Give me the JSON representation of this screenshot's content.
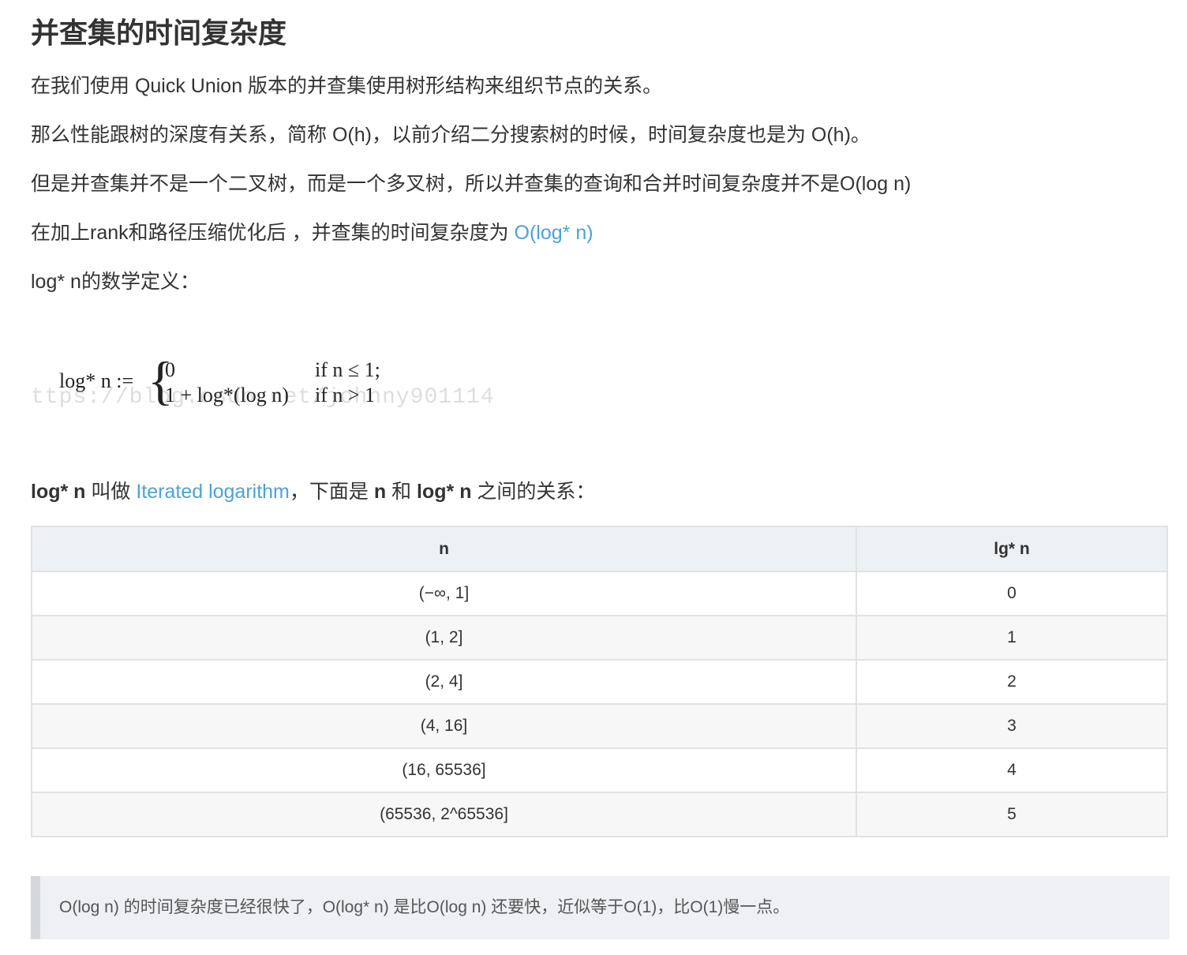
{
  "title": "并查集的时间复杂度",
  "paragraphs": {
    "p1": "在我们使用 Quick Union 版本的并查集使用树形结构来组织节点的关系。",
    "p2": "那么性能跟树的深度有关系，简称 O(h)，以前介绍二分搜索树的时候，时间复杂度也是为 O(h)。",
    "p3": "但是并查集并不是一个二叉树，而是一个多叉树，所以并查集的查询和合并时间复杂度并不是O(log n)",
    "p4_text": "在加上rank和路径压缩优化后 ，并查集的时间复杂度为 ",
    "p4_link": "O(log* n)",
    "p5": "log* n的数学定义："
  },
  "formula": {
    "lhs": "log* n :=",
    "case1_value": "0",
    "case1_cond": "if n ≤ 1;",
    "case2_value": "1 + log*(log n)",
    "case2_cond": "if n > 1",
    "watermark": "ttps://blog.csdn.net/johnny901114"
  },
  "iterated": {
    "term1": "log* n",
    "text1": " 叫做 ",
    "link": "Iterated logarithm",
    "text2": "，下面是 ",
    "term2": "n",
    "text3": " 和 ",
    "term3": "log* n",
    "text4": " 之间的关系："
  },
  "table": {
    "headers": [
      "n",
      "lg* n"
    ],
    "rows": [
      [
        "(−∞, 1]",
        "0"
      ],
      [
        "(1, 2]",
        "1"
      ],
      [
        "(2, 4]",
        "2"
      ],
      [
        "(4, 16]",
        "3"
      ],
      [
        "(16, 65536]",
        "4"
      ],
      [
        "(65536, 2^65536]",
        "5"
      ]
    ]
  },
  "quote": "O(log n) 的时间复杂度已经很快了，O(log* n) 是比O(log n) 还要快，近似等于O(1)，比O(1)慢一点。",
  "colors": {
    "link": "#4ba3d6",
    "text": "#333333",
    "table_border": "#dfe2e5",
    "table_header_bg": "#eef1f4",
    "quote_bg": "#eef0f3"
  }
}
